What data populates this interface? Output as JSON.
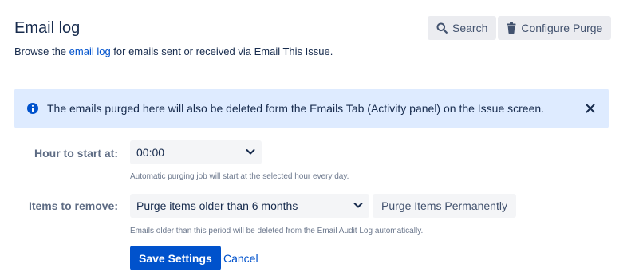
{
  "header": {
    "title": "Email log",
    "subtitle_prefix": "Browse the ",
    "subtitle_link": "email log",
    "subtitle_suffix": " for emails sent or received via Email This Issue."
  },
  "actions": {
    "search_label": "Search",
    "configure_purge_label": "Configure Purge"
  },
  "banner": {
    "message": "The emails purged here will also be deleted form the Emails Tab (Activity panel) on the Issue screen."
  },
  "form": {
    "hour": {
      "label": "Hour to start at:",
      "value": "00:00",
      "help": "Automatic purging job will start at the selected hour every day."
    },
    "items": {
      "label": "Items to remove:",
      "value": "Purge items older than 6 months",
      "purge_button": "Purge Items Permanently",
      "help": "Emails older than this period will be deleted from the Email Audit Log automatically."
    },
    "save_label": "Save Settings",
    "cancel_label": "Cancel"
  },
  "icons": {
    "search": "search-icon",
    "purge": "trash-icon",
    "info": "info-icon",
    "close": "close-icon",
    "chevron": "chevron-down-icon"
  },
  "colors": {
    "primary": "#0052cc",
    "banner_bg": "#deebff",
    "button_bg": "#ebecf0",
    "text": "#172b4d",
    "muted": "#5e6c84"
  }
}
